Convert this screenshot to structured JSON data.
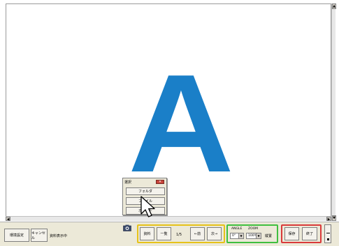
{
  "viewer": {
    "letter": "A",
    "letter_color": "#1a7fc8"
  },
  "dialog": {
    "title": "選択",
    "close_label": "✕",
    "options": [
      "フォルダ",
      "ファイル",
      "ホワイト"
    ]
  },
  "toolbar": {
    "env_settings": "環境設定",
    "cancel": "キャンセル",
    "status": "資料表示中",
    "document": "資料",
    "list": "一覧",
    "page": "1/5",
    "prev": "←前",
    "next": "次→",
    "angle_label": "ANGLE",
    "angle_value": "0°",
    "zoom_label": "ZOOM",
    "zoom_value": "100%",
    "vertical": "縦置",
    "save": "保存",
    "exit": "終了"
  },
  "colors": {
    "group_yellow": "#e6c21a",
    "group_green": "#3fbf3f",
    "group_red": "#d93a3a"
  }
}
